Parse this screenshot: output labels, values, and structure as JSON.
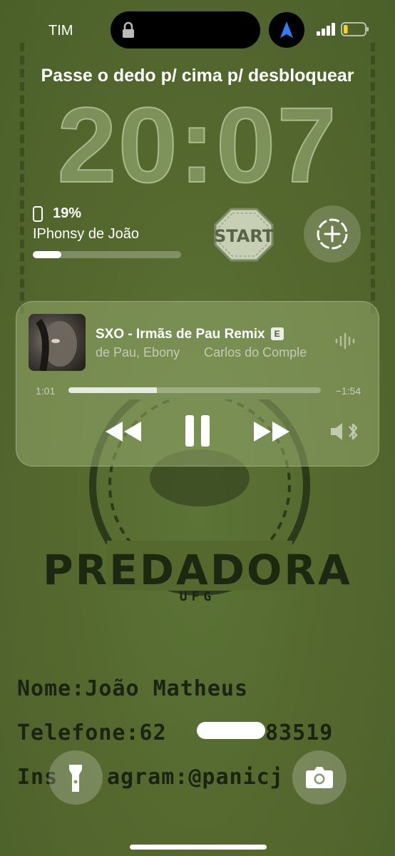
{
  "status_bar": {
    "carrier": "TIM",
    "icons": [
      "lock-icon",
      "location-arrow-icon",
      "signal-icon",
      "battery-icon"
    ],
    "battery_fill": 0.2
  },
  "lock_screen": {
    "swipe_hint": "Passe o dedo p/ cima p/ desbloquear",
    "time": "20:07"
  },
  "battery_widget": {
    "percent_text": "19%",
    "device_name": "IPhonsy de João",
    "level": 0.19
  },
  "start_widget": {
    "label": "START"
  },
  "now_playing": {
    "title": "SXO - Irmãs de Pau Remix",
    "explicit_badge": "E",
    "artist_parts": [
      "de Pau, Ebony",
      "Carlos do Comple"
    ],
    "elapsed": "1:01",
    "remaining": "−1:54",
    "progress": 0.35,
    "controls": [
      "rewind-icon",
      "pause-icon",
      "fast-forward-icon",
      "bluetooth-speaker-icon"
    ]
  },
  "wallpaper": {
    "logo_text": "PREDADORA",
    "logo_subtext": "UFG",
    "lines": [
      "Nome:João Matheus",
      "Telefone:62",
      "83519",
      "Ins",
      "agram:@panicj"
    ]
  },
  "colors": {
    "background": "#556b33",
    "accent": "#ffffff"
  }
}
